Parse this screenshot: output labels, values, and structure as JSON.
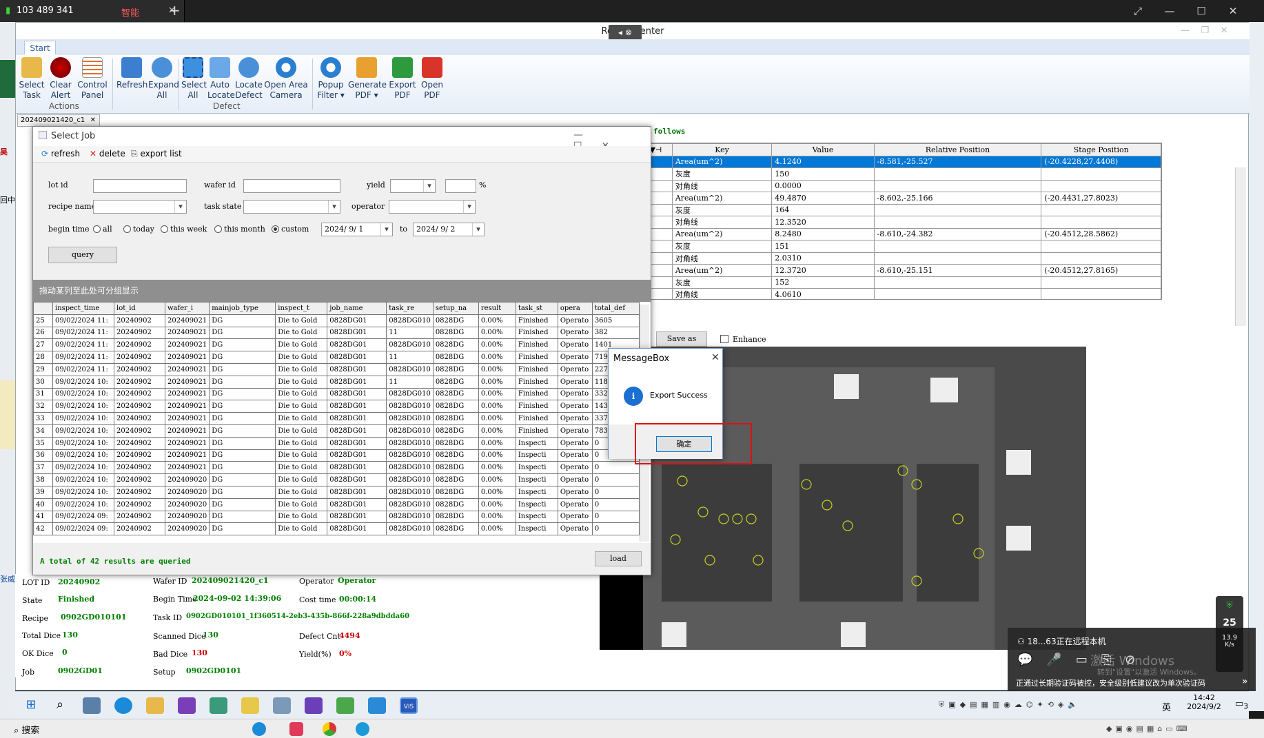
{
  "remote": {
    "tab_title": "103 489 341",
    "tab_tag": "智能",
    "add_tab": "+",
    "popup_status": "18...63正在远程本机",
    "popup_notice": "正通过长期验证码被控，安全级别低建议改为单次验证码",
    "activate_watermark_1": "激活 Windows",
    "activate_watermark_2": "转到\"设置\"以激活 Windows。",
    "net_percent": "25",
    "net_speed": "13.9",
    "net_unit": "K/s"
  },
  "app": {
    "title": "Report Center",
    "ribbon_tab": "Start",
    "buttons": {
      "select_task": "Select\nTask",
      "clear_alert": "Clear\nAlert",
      "control_panel": "Control\nPanel",
      "refresh": "Refresh",
      "expand_all": "Expand\nAll",
      "select_all": "Select\nAll",
      "auto_locate": "Auto\nLocate",
      "locate_defect": "Locate\nDefect",
      "open_area_camera": "Open Area\nCamera",
      "popup_filter": "Popup\nFilter ▾",
      "generate_pdf": "Generate\nPDF ▾",
      "export_pdf": "Export\nPDF",
      "open_pdf": "Open\nPDF"
    },
    "groups": {
      "actions": "Actions",
      "defect": "Defect"
    },
    "doc_tab": "202409021420_c1",
    "follows_text": "follows",
    "save_as": "Save as",
    "enhance": "Enhance"
  },
  "defect_grid": {
    "headers": [
      "Key",
      "Value",
      "Relative Position",
      "Stage Position"
    ],
    "rows": [
      {
        "key": "Area(um^2)",
        "value": "4.1240",
        "rel": "-8.581,-25.527",
        "stage": "(-20.4228,27.4408)",
        "selected": true
      },
      {
        "key": "灰度",
        "value": "150",
        "rel": "",
        "stage": ""
      },
      {
        "key": "对角线",
        "value": "0.0000",
        "rel": "",
        "stage": ""
      },
      {
        "key": "Area(um^2)",
        "value": "49.4870",
        "rel": "-8.602,-25.166",
        "stage": "(-20.4431,27.8023)"
      },
      {
        "key": "灰度",
        "value": "164",
        "rel": "",
        "stage": ""
      },
      {
        "key": "对角线",
        "value": "12.3520",
        "rel": "",
        "stage": ""
      },
      {
        "key": "Area(um^2)",
        "value": "8.2480",
        "rel": "-8.610,-24.382",
        "stage": "(-20.4512,28.5862)"
      },
      {
        "key": "灰度",
        "value": "151",
        "rel": "",
        "stage": ""
      },
      {
        "key": "对角线",
        "value": "2.0310",
        "rel": "",
        "stage": ""
      },
      {
        "key": "Area(um^2)",
        "value": "12.3720",
        "rel": "-8.610,-25.151",
        "stage": "(-20.4512,27.8165)"
      },
      {
        "key": "灰度",
        "value": "152",
        "rel": "",
        "stage": ""
      },
      {
        "key": "对角线",
        "value": "4.0610",
        "rel": "",
        "stage": ""
      }
    ]
  },
  "select_job": {
    "title": "Select Job",
    "toolbar": {
      "refresh": "refresh",
      "delete": "delete",
      "export": "export list"
    },
    "labels": {
      "lot_id": "lot id",
      "wafer_id": "wafer id",
      "yield": "yield",
      "percent": "%",
      "recipe_name": "recipe name",
      "task_state": "task state",
      "operator": "operator",
      "begin_time": "begin time",
      "all": "all",
      "today": "today",
      "this_week": "this week",
      "this_month": "this month",
      "custom": "custom",
      "to": "to"
    },
    "date_from": "2024/ 9/ 1",
    "date_to": "2024/ 9/ 2",
    "query": "query",
    "group_hint": "拖动某列至此处可分组显示",
    "columns": [
      "inspect_time",
      "lot_id",
      "wafer_i",
      "mainjob_type",
      "inspect_t",
      "job_name",
      "task_re",
      "setup_na",
      "result",
      "task_st",
      "opera",
      "total_def"
    ],
    "rows": [
      [
        "25",
        "09/02/2024 11:",
        "20240902",
        "202409021",
        "DG",
        "Die to Gold",
        "0828DG01",
        "0828DG010",
        "0828DG",
        "0.00%",
        "Finished",
        "Operato",
        "3605"
      ],
      [
        "26",
        "09/02/2024 11:",
        "20240902",
        "202409021",
        "DG",
        "Die to Gold",
        "0828DG01",
        "11",
        "0828DG",
        "0.00%",
        "Finished",
        "Operato",
        "382"
      ],
      [
        "27",
        "09/02/2024 11:",
        "20240902",
        "202409021",
        "DG",
        "Die to Gold",
        "0828DG01",
        "0828DG010",
        "0828DG",
        "0.00%",
        "Finished",
        "Operato",
        "1401"
      ],
      [
        "28",
        "09/02/2024 11:",
        "20240902",
        "202409021",
        "DG",
        "Die to Gold",
        "0828DG01",
        "11",
        "0828DG",
        "0.00%",
        "Finished",
        "Operato",
        "719"
      ],
      [
        "29",
        "09/02/2024 11:",
        "20240902",
        "202409021",
        "DG",
        "Die to Gold",
        "0828DG01",
        "0828DG010",
        "0828DG",
        "0.00%",
        "Finished",
        "Operato",
        "2270"
      ],
      [
        "30",
        "09/02/2024 10:",
        "20240902",
        "202409021",
        "DG",
        "Die to Gold",
        "0828DG01",
        "11",
        "0828DG",
        "0.00%",
        "Finished",
        "Operato",
        "1183"
      ],
      [
        "31",
        "09/02/2024 10:",
        "20240902",
        "202409021",
        "DG",
        "Die to Gold",
        "0828DG01",
        "0828DG010",
        "0828DG",
        "0.00%",
        "Finished",
        "Operato",
        "3320"
      ],
      [
        "32",
        "09/02/2024 10:",
        "20240902",
        "202409021",
        "DG",
        "Die to Gold",
        "0828DG01",
        "0828DG010",
        "0828DG",
        "0.00%",
        "Finished",
        "Operato",
        "1436"
      ],
      [
        "33",
        "09/02/2024 10:",
        "20240902",
        "202409021",
        "DG",
        "Die to Gold",
        "0828DG01",
        "0828DG010",
        "0828DG",
        "0.00%",
        "Finished",
        "Operato",
        "3372"
      ],
      [
        "34",
        "09/02/2024 10:",
        "20240902",
        "202409021",
        "DG",
        "Die to Gold",
        "0828DG01",
        "0828DG010",
        "0828DG",
        "0.00%",
        "Finished",
        "Operato",
        "783"
      ],
      [
        "35",
        "09/02/2024 10:",
        "20240902",
        "202409021",
        "DG",
        "Die to Gold",
        "0828DG01",
        "0828DG010",
        "0828DG",
        "0.00%",
        "Inspecti",
        "Operato",
        "0"
      ],
      [
        "36",
        "09/02/2024 10:",
        "20240902",
        "202409021",
        "DG",
        "Die to Gold",
        "0828DG01",
        "0828DG010",
        "0828DG",
        "0.00%",
        "Inspecti",
        "Operato",
        "0"
      ],
      [
        "37",
        "09/02/2024 10:",
        "20240902",
        "202409021",
        "DG",
        "Die to Gold",
        "0828DG01",
        "0828DG010",
        "0828DG",
        "0.00%",
        "Inspecti",
        "Operato",
        "0"
      ],
      [
        "38",
        "09/02/2024 10:",
        "20240902",
        "202409020",
        "DG",
        "Die to Gold",
        "0828DG01",
        "0828DG010",
        "0828DG",
        "0.00%",
        "Inspecti",
        "Operato",
        "0"
      ],
      [
        "39",
        "09/02/2024 10:",
        "20240902",
        "202409020",
        "DG",
        "Die to Gold",
        "0828DG01",
        "0828DG010",
        "0828DG",
        "0.00%",
        "Inspecti",
        "Operato",
        "0"
      ],
      [
        "40",
        "09/02/2024 10:",
        "20240902",
        "202409020",
        "DG",
        "Die to Gold",
        "0828DG01",
        "0828DG010",
        "0828DG",
        "0.00%",
        "Inspecti",
        "Operato",
        "0"
      ],
      [
        "41",
        "09/02/2024 09:",
        "20240902",
        "202409020",
        "DG",
        "Die to Gold",
        "0828DG01",
        "0828DG010",
        "0828DG",
        "0.00%",
        "Inspecti",
        "Operato",
        "0"
      ],
      [
        "42",
        "09/02/2024 09:",
        "20240902",
        "202409020",
        "DG",
        "Die to Gold",
        "0828DG01",
        "0828DG010",
        "0828DG",
        "0.00%",
        "Inspecti",
        "Operato",
        "0"
      ]
    ],
    "summary": "A total of 42 results are queried",
    "load": "load"
  },
  "info": {
    "lot_id_k": "LOT ID",
    "lot_id_v": "20240902",
    "wafer_id_k": "Wafer ID",
    "wafer_id_v": "202409021420_c1",
    "operator_k": "Operator",
    "operator_v": "Operator",
    "state_k": "State",
    "state_v": "Finished",
    "begin_k": "Begin Time",
    "begin_v": "2024-09-02 14:39:06",
    "cost_k": "Cost time",
    "cost_v": "00:00:14",
    "recipe_k": "Recipe",
    "recipe_v": "0902GD010101",
    "task_k": "Task ID",
    "task_v": "0902GD010101_1f360514-2eb3-435b-866f-228a9dbdda60",
    "total_k": "Total Dice",
    "total_v": "130",
    "scanned_k": "Scanned Dice",
    "scanned_v": "130",
    "defect_k": "Defect Cnt",
    "defect_v": "4494",
    "ok_k": "OK Dice",
    "ok_v": "0",
    "bad_k": "Bad Dice",
    "bad_v": "130",
    "yield_k": "Yield(%)",
    "yield_v": "0%",
    "job_k": "Job",
    "job_v": "0902GD01",
    "setup_k": "Setup",
    "setup_v": "0902GD0101"
  },
  "msgbox": {
    "title": "MessageBox",
    "text": "Export Success",
    "ok": "确定"
  },
  "taskbar": {
    "time": "14:42",
    "date": "2024/9/2",
    "ime": "英",
    "search": "搜索",
    "notif": "3"
  },
  "colors": {
    "ribbon_text": "#1d3a66",
    "selected_row": "#0078d7",
    "value_green": "#008000",
    "value_red": "#cc0000",
    "highlight_box": "#e01010"
  }
}
